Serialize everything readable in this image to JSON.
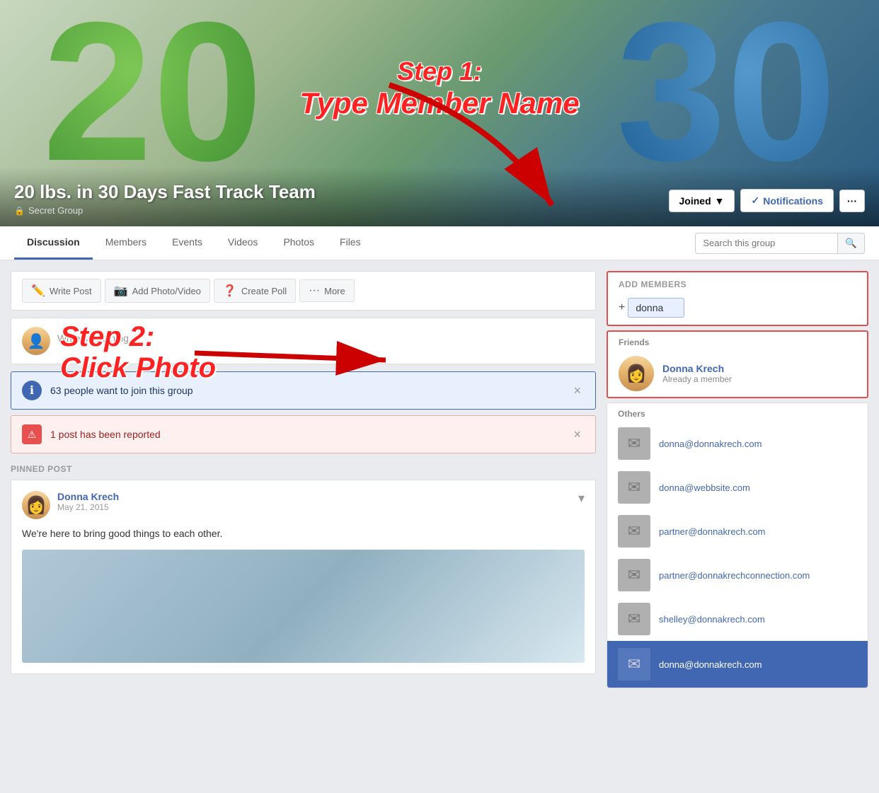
{
  "cover": {
    "group_name": "20 lbs. in 30 Days Fast Track Team",
    "group_type": "Secret Group",
    "step1_line1": "Step 1:",
    "step1_line2": "Type Member Name",
    "btn_joined": "Joined",
    "btn_notifications": "Notifications",
    "btn_more": "···"
  },
  "nav": {
    "tabs": [
      {
        "label": "Discussion",
        "active": true
      },
      {
        "label": "Members",
        "active": false
      },
      {
        "label": "Events",
        "active": false
      },
      {
        "label": "Videos",
        "active": false
      },
      {
        "label": "Photos",
        "active": false
      },
      {
        "label": "Files",
        "active": false
      }
    ],
    "search_placeholder": "Search this group"
  },
  "post_bar": {
    "write_post": "Write Post",
    "add_photo": "Add Photo/Video",
    "create_poll": "Create Poll",
    "more": "More"
  },
  "compose": {
    "placeholder": "Write something..."
  },
  "step2": {
    "line1": "Step 2:",
    "line2": "Click Photo"
  },
  "banners": {
    "join_request": "63 people want to join this group",
    "report": "1 post has been reported"
  },
  "pinned": {
    "label": "PINNED POST",
    "author_name": "Donna Krech",
    "post_date": "May 21, 2015",
    "post_text": "We're here to bring good things to each other."
  },
  "add_members": {
    "header": "ADD MEMBERS",
    "input_value": "donna",
    "plus": "+"
  },
  "friends": {
    "label": "Friends",
    "items": [
      {
        "name": "Donna Krech",
        "status": "Already a member"
      }
    ]
  },
  "others": {
    "label": "Others",
    "items": [
      {
        "email": "donna@donnakrech.com"
      },
      {
        "email": "donna@webbsite.com"
      },
      {
        "email": "partner@donnakrech.com"
      },
      {
        "email": "partner@donnakrechconnection.com"
      },
      {
        "email": "shelley@donnakrech.com"
      },
      {
        "email": "donna@donnakrech.com",
        "highlighted": true
      }
    ]
  }
}
